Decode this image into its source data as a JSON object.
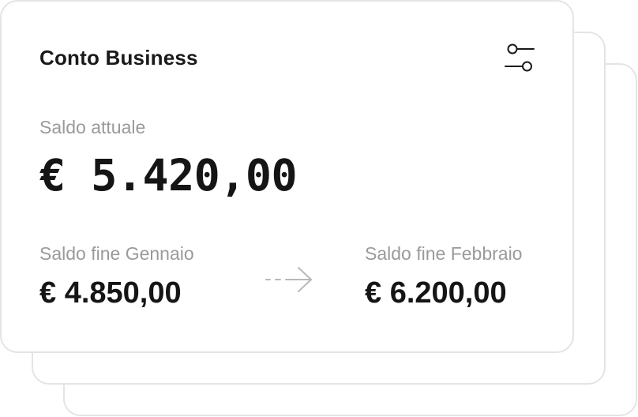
{
  "card": {
    "title": "Conto Business",
    "settings_icon": "sliders-icon",
    "current_balance": {
      "label": "Saldo attuale",
      "amount": "€ 5.420,00"
    },
    "january_balance": {
      "label": "Saldo fine Gennaio",
      "amount": "€ 4.850,00"
    },
    "february_balance": {
      "label": "Saldo fine Febbraio",
      "amount": "€ 6.200,00"
    },
    "transition_icon": "dashed-arrow-right-icon"
  },
  "colors": {
    "text_primary": "#151515",
    "text_secondary": "#9a9a9a",
    "card_border": "#e4e4e4",
    "background": "#ffffff"
  }
}
